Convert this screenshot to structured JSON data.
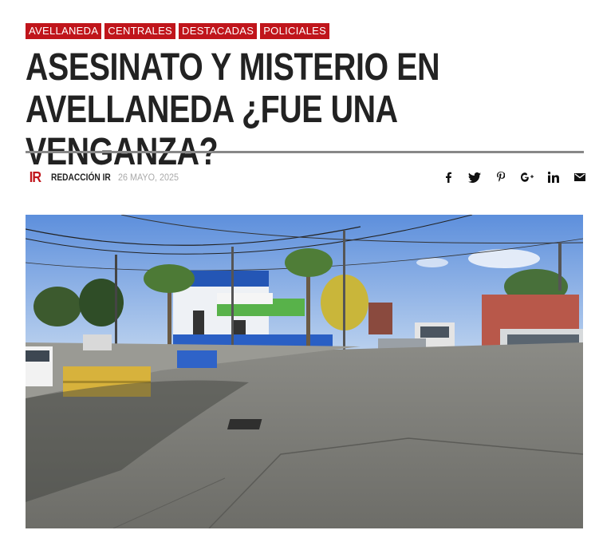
{
  "categories": [
    "AVELLANEDA",
    "CENTRALES",
    "DESTACADAS",
    "POLICIALES"
  ],
  "article": {
    "title_line1": "ASESINATO Y MISTERIO EN",
    "title_line2": "AVELLANEDA ¿FUE UNA VENGANZA?",
    "logo": "IR",
    "author": "REDACCIÓN IR",
    "date": "26 MAYO, 2025"
  },
  "share": {
    "facebook": "f",
    "twitter": "🐦",
    "pinterest": "P",
    "googleplus": "g+",
    "linkedin": "in",
    "email": "✉"
  },
  "colors": {
    "accent": "#c0151b",
    "rule": "#888888"
  }
}
